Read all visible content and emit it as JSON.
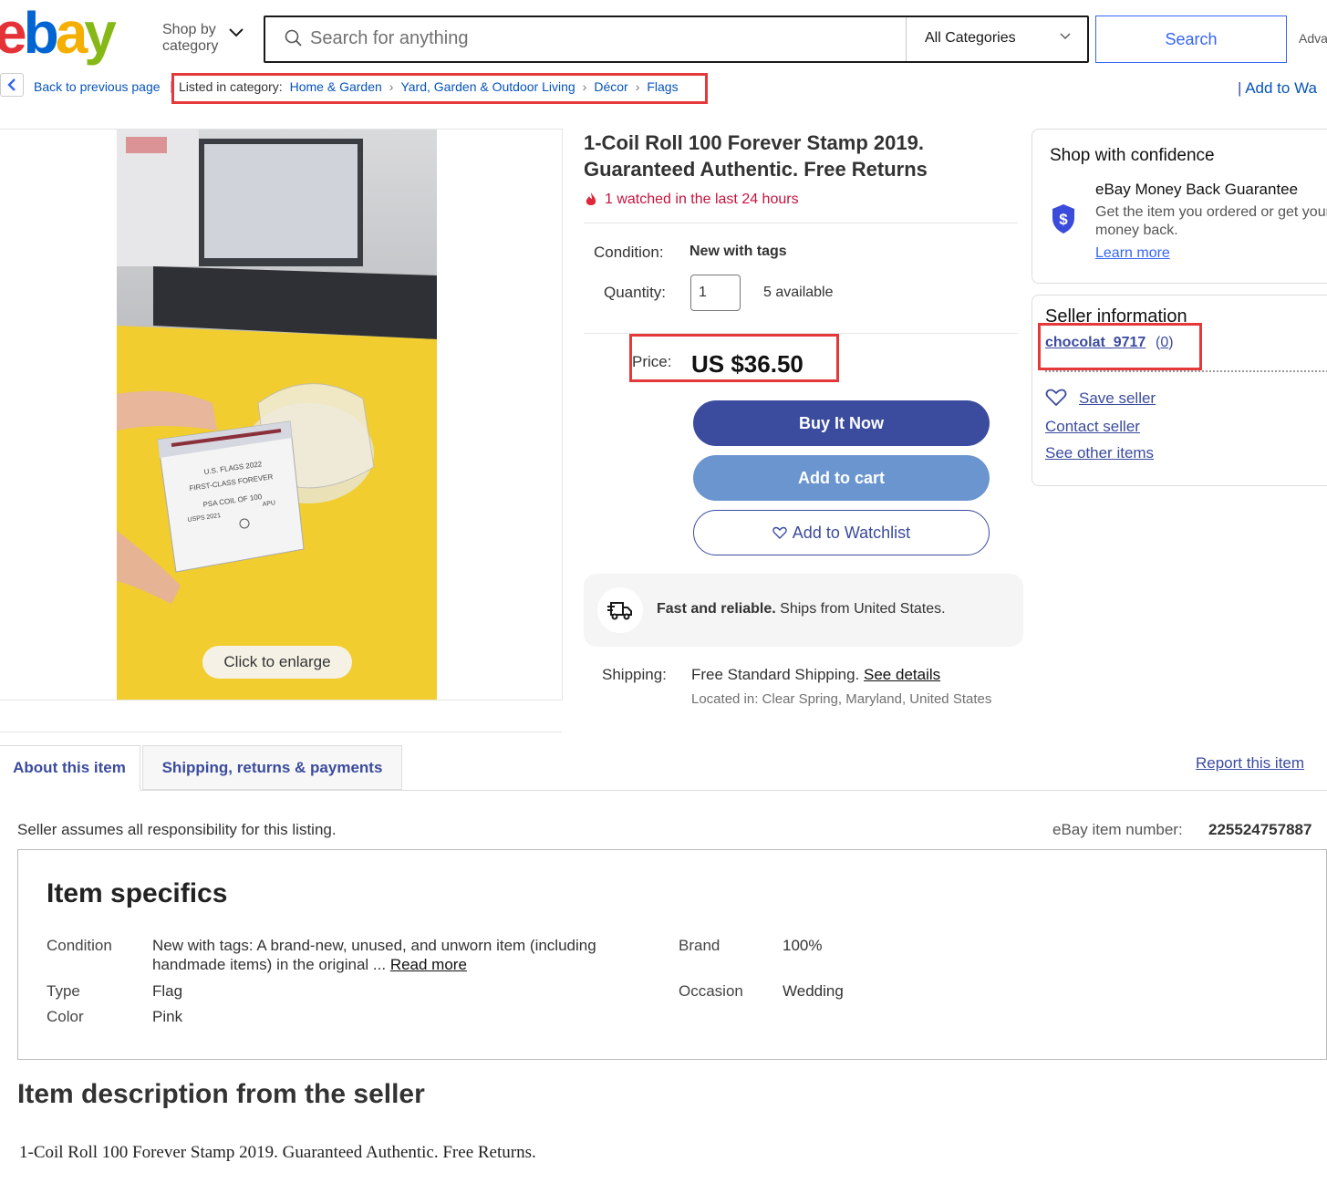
{
  "header": {
    "logo": "ebay",
    "shop_by_category_line1": "Shop by",
    "shop_by_category_line2": "category",
    "search_placeholder": "Search for anything",
    "category_select": "All Categories",
    "search_button": "Search",
    "advanced": "Adva"
  },
  "breadcrumb": {
    "back_label": "Back to previous page",
    "listed_label": "Listed in category:",
    "items": [
      "Home & Garden",
      "Yard, Garden & Outdoor Living",
      "Décor",
      "Flags"
    ],
    "add_to_watchlist": "Add to Wa"
  },
  "image": {
    "enlarge_label": "Click to enlarge",
    "label_lines": [
      "U.S. FLAGS 2022",
      "FIRST-CLASS FOREVER",
      "PSA COIL OF 100",
      "USPS 2021",
      "APU"
    ]
  },
  "listing": {
    "title": "1-Coil Roll 100 Forever Stamp 2019. Guaranteed Authentic. Free Returns",
    "watched": "1 watched in the last 24 hours",
    "condition_label": "Condition:",
    "condition_value": "New with tags",
    "quantity_label": "Quantity:",
    "quantity_value": "1",
    "available": "5 available",
    "price_label": "Price:",
    "price": "US $36.50",
    "buy_now": "Buy It Now",
    "add_to_cart": "Add to cart",
    "add_to_watchlist": "Add to Watchlist",
    "fast_bold": "Fast and reliable.",
    "fast_rest": " Ships from United States.",
    "shipping_label": "Shipping:",
    "shipping_value": "Free Standard Shipping. ",
    "shipping_link": "See details",
    "located": "Located in: Clear Spring, Maryland, United States"
  },
  "confidence": {
    "title": "Shop with confidence",
    "mbg_title": "eBay Money Back Guarantee",
    "mbg_text": "Get the item you ordered or get your money back.",
    "learn_more": "Learn more"
  },
  "seller": {
    "title": "Seller information",
    "name": "chocolat_9717",
    "feedback": "0",
    "save_seller": "Save seller",
    "contact_seller": "Contact seller",
    "see_other_items": "See other items"
  },
  "tabs": {
    "about": "About this item",
    "shipping": "Shipping, returns & payments",
    "report": "Report this item"
  },
  "about": {
    "responsibility": "Seller assumes all responsibility for this listing.",
    "item_number_label": "eBay item number:",
    "item_number": "225524757887",
    "specifics_title": "Item specifics",
    "specs": {
      "condition_key": "Condition",
      "condition_value": "New with tags: A brand-new, unused, and unworn item (including handmade items) in the original ... ",
      "read_more": "Read more",
      "brand_key": "Brand",
      "brand_value": "100%",
      "type_key": "Type",
      "type_value": "Flag",
      "occasion_key": "Occasion",
      "occasion_value": "Wedding",
      "color_key": "Color",
      "color_value": "Pink"
    },
    "description_title": "Item description from the seller",
    "description_text": "1-Coil Roll 100 Forever Stamp 2019. Guaranteed Authentic. Free Returns."
  },
  "colors": {
    "brand_blue": "#3b4b9e",
    "highlight_red": "#e5383b",
    "watch_red": "#c5133d"
  }
}
